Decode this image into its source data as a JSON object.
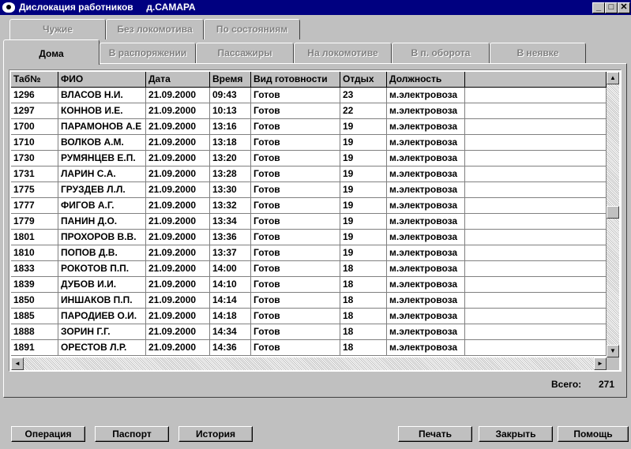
{
  "window": {
    "title": "Дислокация работников     д.САМАРА",
    "min_glyph": "_",
    "max_glyph": "□",
    "close_glyph": "✕"
  },
  "tabs_back": [
    "Чужие",
    "Без локомотива",
    "По состояниям"
  ],
  "tabs_front": [
    "Дома",
    "В распоряжении",
    "Пассажиры",
    "На локомотиве",
    "В п. оборота",
    "В неявке"
  ],
  "active_tab": "Дома",
  "table": {
    "columns": [
      "Таб№",
      "ФИО",
      "Дата",
      "Время",
      "Вид готовности",
      "Отдых",
      "Должность"
    ],
    "rows": [
      [
        "1296",
        "ВЛАСОВ Н.И.",
        "21.09.2000",
        "09:43",
        "Готов",
        "23",
        "м.электровоза"
      ],
      [
        "1297",
        "КОННОВ И.Е.",
        "21.09.2000",
        "10:13",
        "Готов",
        "22",
        "м.электровоза"
      ],
      [
        "1700",
        "ПАРАМОНОВ А.Е",
        "21.09.2000",
        "13:16",
        "Готов",
        "19",
        "м.электровоза"
      ],
      [
        "1710",
        "ВОЛКОВ А.М.",
        "21.09.2000",
        "13:18",
        "Готов",
        "19",
        "м.электровоза"
      ],
      [
        "1730",
        "РУМЯНЦЕВ Е.П.",
        "21.09.2000",
        "13:20",
        "Готов",
        "19",
        "м.электровоза"
      ],
      [
        "1731",
        "ЛАРИН С.А.",
        "21.09.2000",
        "13:28",
        "Готов",
        "19",
        "м.электровоза"
      ],
      [
        "1775",
        "ГРУЗДЕВ Л.Л.",
        "21.09.2000",
        "13:30",
        "Готов",
        "19",
        "м.электровоза"
      ],
      [
        "1777",
        "ФИГОВ А.Г.",
        "21.09.2000",
        "13:32",
        "Готов",
        "19",
        "м.электровоза"
      ],
      [
        "1779",
        "ПАНИН Д.О.",
        "21.09.2000",
        "13:34",
        "Готов",
        "19",
        "м.электровоза"
      ],
      [
        "1801",
        "ПРОХОРОВ В.В.",
        "21.09.2000",
        "13:36",
        "Готов",
        "19",
        "м.электровоза"
      ],
      [
        "1810",
        "ПОПОВ Д.В.",
        "21.09.2000",
        "13:37",
        "Готов",
        "19",
        "м.электровоза"
      ],
      [
        "1833",
        "РОКОТОВ П.П.",
        "21.09.2000",
        "14:00",
        "Готов",
        "18",
        "м.электровоза"
      ],
      [
        "1839",
        "ДУБОВ И.И.",
        "21.09.2000",
        "14:10",
        "Готов",
        "18",
        "м.электровоза"
      ],
      [
        "1850",
        "ИНШАКОВ П.П.",
        "21.09.2000",
        "14:14",
        "Готов",
        "18",
        "м.электровоза"
      ],
      [
        "1885",
        "ПАРОДИЕВ О.И.",
        "21.09.2000",
        "14:18",
        "Готов",
        "18",
        "м.электровоза"
      ],
      [
        "1888",
        "ЗОРИН Г.Г.",
        "21.09.2000",
        "14:34",
        "Готов",
        "18",
        "м.электровоза"
      ],
      [
        "1891",
        "ОРЕСТОВ Л.Р.",
        "21.09.2000",
        "14:36",
        "Готов",
        "18",
        "м.электровоза"
      ]
    ]
  },
  "total": {
    "label": "Всего:",
    "value": "271"
  },
  "buttons": {
    "operation": "Операция",
    "passport": "Паспорт",
    "history": "История",
    "print": "Печать",
    "close": "Закрыть",
    "help": "Помощь"
  },
  "icons": {
    "app": "eye-icon",
    "scroll_up": "▲",
    "scroll_down": "▼",
    "scroll_left": "◄",
    "scroll_right": "►"
  }
}
